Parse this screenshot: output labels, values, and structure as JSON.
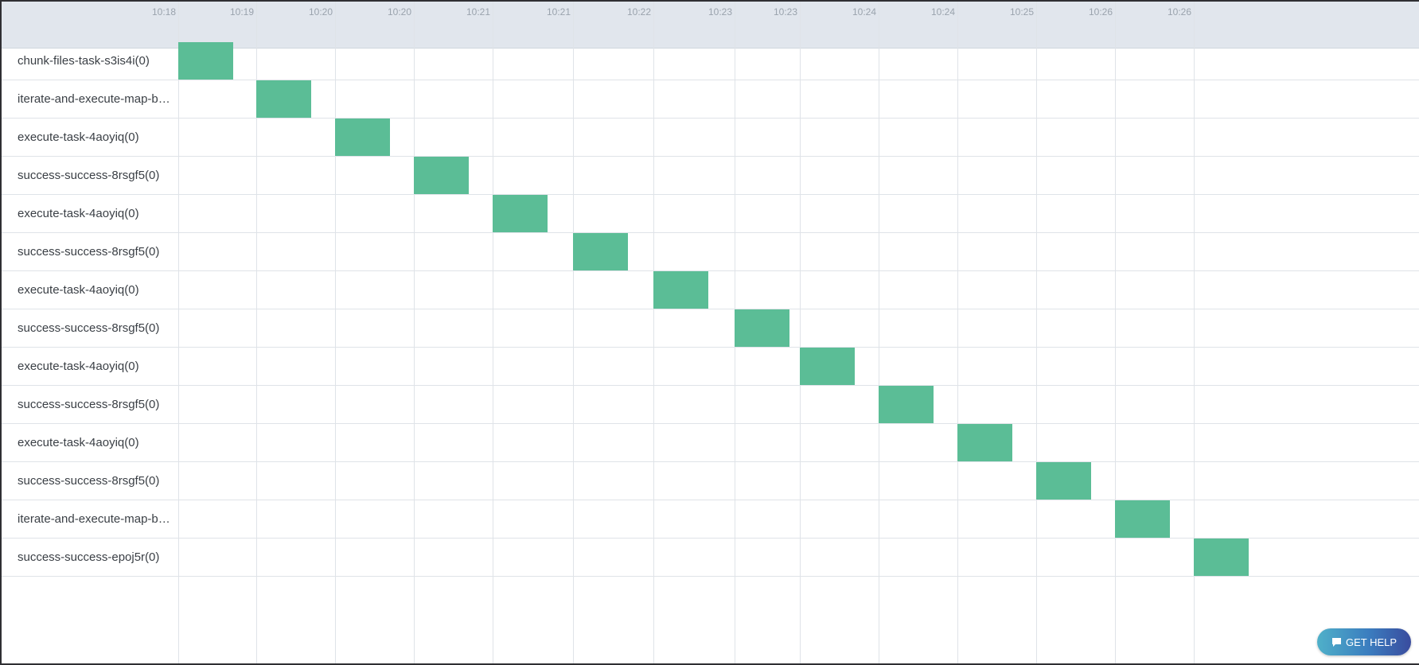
{
  "timeline": {
    "ticks": [
      "10:18",
      "10:19",
      "10:20",
      "10:20",
      "10:21",
      "10:21",
      "10:22",
      "10:23",
      "10:23",
      "10:24",
      "10:24",
      "10:25",
      "10:26",
      "10:26"
    ],
    "rows": [
      {
        "label": "chunk-files-task-s3is4i(0)"
      },
      {
        "label": "iterate-and-execute-map-b…"
      },
      {
        "label": "execute-task-4aoyiq(0)"
      },
      {
        "label": "success-success-8rsgf5(0)"
      },
      {
        "label": "execute-task-4aoyiq(0)"
      },
      {
        "label": "success-success-8rsgf5(0)"
      },
      {
        "label": "execute-task-4aoyiq(0)"
      },
      {
        "label": "success-success-8rsgf5(0)"
      },
      {
        "label": "execute-task-4aoyiq(0)"
      },
      {
        "label": "success-success-8rsgf5(0)"
      },
      {
        "label": "execute-task-4aoyiq(0)"
      },
      {
        "label": "success-success-8rsgf5(0)"
      },
      {
        "label": "iterate-and-execute-map-b…"
      },
      {
        "label": "success-success-epoj5r(0)"
      }
    ],
    "bar_color": "#5bbd96"
  },
  "help": {
    "label": "GET HELP",
    "icon": "chat-bubble-icon"
  }
}
